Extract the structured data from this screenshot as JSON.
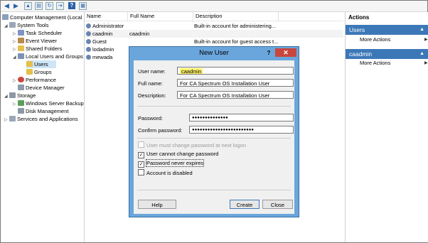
{
  "tree": {
    "items": [
      {
        "label": "Computer Management (Local"
      },
      {
        "label": "System Tools"
      },
      {
        "label": "Task Scheduler"
      },
      {
        "label": "Event Viewer"
      },
      {
        "label": "Shared Folders"
      },
      {
        "label": "Local Users and Groups"
      },
      {
        "label": "Users"
      },
      {
        "label": "Groups"
      },
      {
        "label": "Performance"
      },
      {
        "label": "Device Manager"
      },
      {
        "label": "Storage"
      },
      {
        "label": "Windows Server Backup"
      },
      {
        "label": "Disk Management"
      },
      {
        "label": "Services and Applications"
      }
    ]
  },
  "list": {
    "columns": [
      "Name",
      "Full Name",
      "Description"
    ],
    "rows": [
      {
        "name": "Administrator",
        "full_name": "",
        "description": "Built-in account for administering..."
      },
      {
        "name": "caadmin",
        "full_name": "caadmin",
        "description": ""
      },
      {
        "name": "Guest",
        "full_name": "",
        "description": "Built-in account for guest access t..."
      },
      {
        "name": "lodadmin",
        "full_name": "",
        "description": ""
      },
      {
        "name": "mewada",
        "full_name": "",
        "description": ""
      }
    ]
  },
  "actions": {
    "title": "Actions",
    "sections": [
      {
        "label": "Users",
        "item": "More Actions"
      },
      {
        "label": "caadmin",
        "item": "More Actions"
      }
    ]
  },
  "dialog": {
    "title": "New User",
    "help_glyph": "?",
    "close_glyph": "✕",
    "fields": {
      "username_label": "User name:",
      "username_value": "caadmin",
      "fullname_label": "Full name:",
      "fullname_value": "For CA Spectrum OS Installation User",
      "description_label": "Description:",
      "description_value": "For CA Spectrum OS Installation User",
      "password_label": "Password:",
      "password_value": "●●●●●●●●●●●●●●",
      "confirm_label": "Confirm password:",
      "confirm_value": "●●●●●●●●●●●●●●●●●●●●●●●●"
    },
    "checkboxes": [
      {
        "label": "User must change password at next logon",
        "checked": false,
        "disabled": true
      },
      {
        "label": "User cannot change password",
        "checked": true,
        "disabled": false
      },
      {
        "label": "Password never expires",
        "checked": true,
        "disabled": false
      },
      {
        "label": "Account is disabled",
        "checked": false,
        "disabled": false
      }
    ],
    "buttons": {
      "help": "Help",
      "create": "Create",
      "close": "Close"
    }
  },
  "colors": {
    "accent": "#3c78b8",
    "dialog_frame": "#6aa6db",
    "close": "#c9463d",
    "highlight": "#fff36a"
  }
}
